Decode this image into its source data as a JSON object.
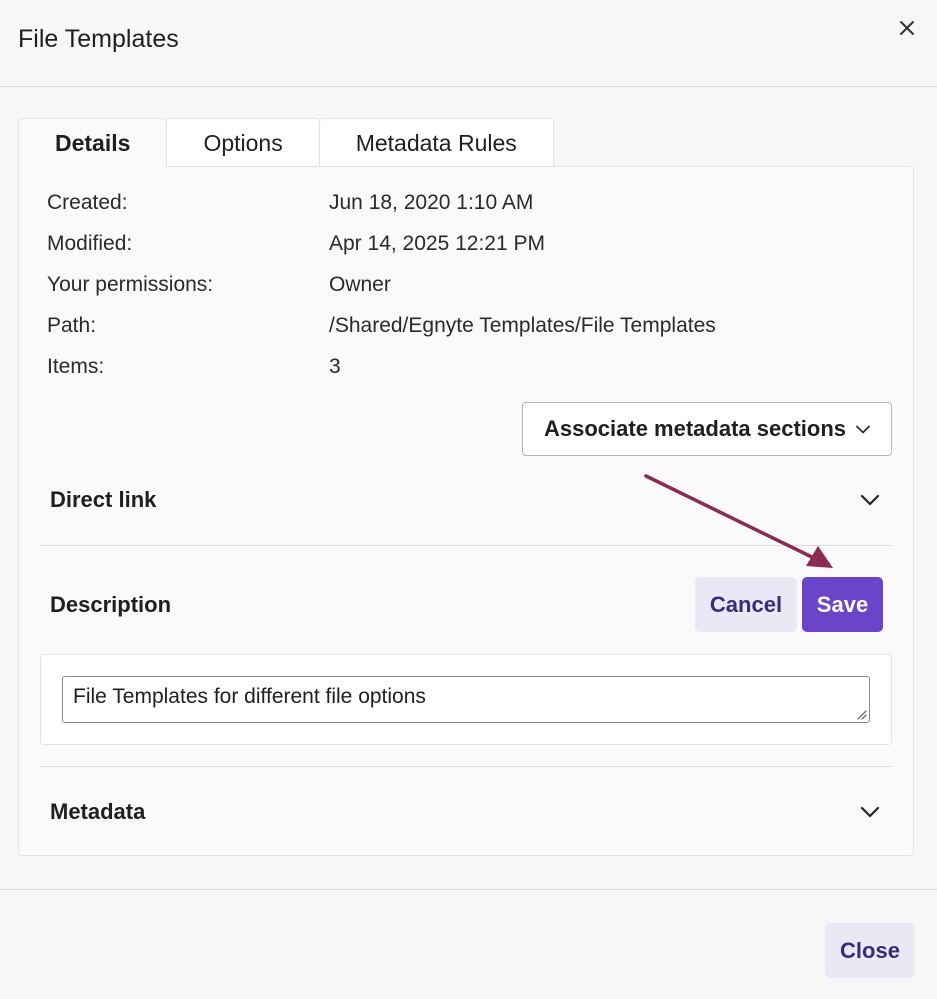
{
  "dialog": {
    "title": "File Templates",
    "close_icon": "close-icon"
  },
  "tabs": [
    {
      "label": "Details",
      "active": true
    },
    {
      "label": "Options",
      "active": false
    },
    {
      "label": "Metadata Rules",
      "active": false
    }
  ],
  "details": {
    "rows": [
      {
        "label": "Created:",
        "value": "Jun 18, 2020 1:10 AM"
      },
      {
        "label": "Modified:",
        "value": "Apr 14, 2025 12:21 PM"
      },
      {
        "label": "Your permissions:",
        "value": "Owner"
      },
      {
        "label": "Path:",
        "value": "/Shared/Egnyte Templates/File Templates"
      },
      {
        "label": "Items:",
        "value": "3"
      }
    ]
  },
  "associate_button": {
    "label": "Associate metadata sections",
    "icon": "chevron-down-icon"
  },
  "direct_link": {
    "title": "Direct link",
    "icon": "chevron-down-icon"
  },
  "description": {
    "title": "Description",
    "cancel_label": "Cancel",
    "save_label": "Save",
    "value": "File Templates for different file options"
  },
  "metadata": {
    "title": "Metadata",
    "icon": "chevron-down-icon"
  },
  "footer": {
    "close_label": "Close"
  },
  "colors": {
    "accent": "#6a45c9",
    "secondary_button_bg": "#ebe7f5",
    "secondary_button_text": "#3a2a7a",
    "annotation_arrow": "#8b2a52"
  }
}
